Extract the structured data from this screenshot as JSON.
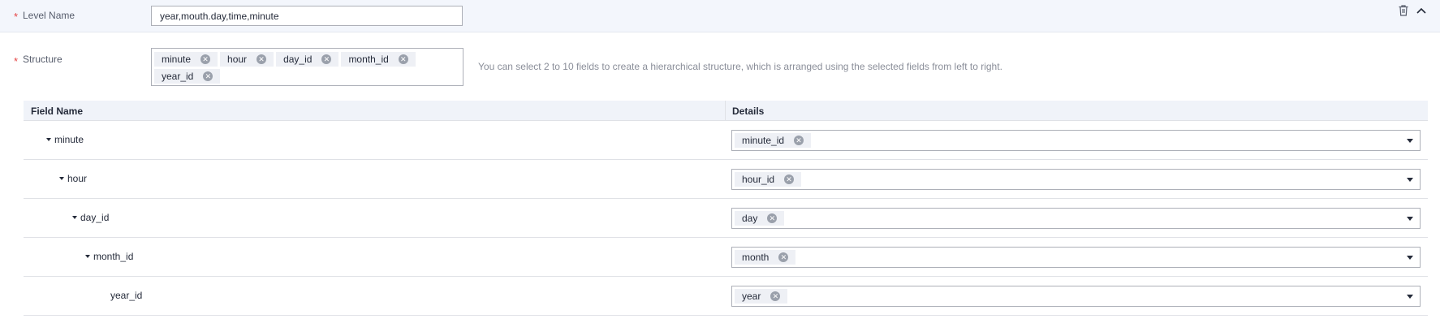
{
  "level_name": {
    "label": "Level Name",
    "value": "year,mouth.day,time,minute"
  },
  "structure": {
    "label": "Structure",
    "tags": [
      "minute",
      "hour",
      "day_id",
      "month_id",
      "year_id"
    ],
    "hint": "You can select 2 to 10 fields to create a hierarchical structure, which is arranged using the selected fields from left to right."
  },
  "table": {
    "headers": [
      "Field Name",
      "Details"
    ],
    "rows": [
      {
        "field": "minute",
        "detail": "minute_id"
      },
      {
        "field": "hour",
        "detail": "hour_id"
      },
      {
        "field": "day_id",
        "detail": "day"
      },
      {
        "field": "month_id",
        "detail": "month"
      },
      {
        "field": "year_id",
        "detail": "year"
      }
    ]
  },
  "icons": {
    "delete": "trash-icon",
    "collapse": "chevron-up-icon",
    "remove_tag": "close-circle-icon",
    "tree_toggle": "caret-down-icon",
    "dropdown": "caret-down-icon"
  },
  "colors": {
    "required": "#e54545",
    "header_bg": "#f3f6fc",
    "tag_bg": "#eef0f5",
    "border": "#adb0b8"
  }
}
